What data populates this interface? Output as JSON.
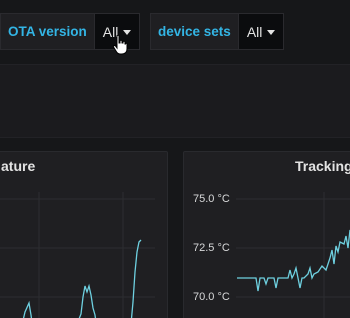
{
  "variables": [
    {
      "label": "OTA version",
      "value": "All"
    },
    {
      "label": "device sets",
      "value": "All"
    }
  ],
  "panels": [
    {
      "title": "ature"
    },
    {
      "title": "Tracking",
      "y_ticks": [
        "75.0 °C",
        "72.5 °C",
        "70.0 °C"
      ]
    }
  ],
  "colors": {
    "series": "#6ed0e0",
    "accent": "#33b5e5"
  }
}
